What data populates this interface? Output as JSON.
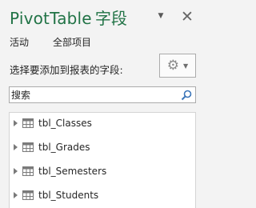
{
  "pane": {
    "title_latin": "PivotTable",
    "title_zh": "字段"
  },
  "tabs": [
    "活动",
    "全部项目"
  ],
  "instruction": "选择要添加到报表的字段:",
  "search": {
    "placeholder": "搜索"
  },
  "fields": [
    {
      "label": "tbl_Classes",
      "icon": "table-icon"
    },
    {
      "label": "tbl_Grades",
      "icon": "table-icon"
    },
    {
      "label": "tbl_Semesters",
      "icon": "table-icon"
    },
    {
      "label": "tbl_Students",
      "icon": "table-icon"
    }
  ],
  "colors": {
    "title": "#217346",
    "background": "#f3f3f3",
    "list_background": "#ffffff",
    "border": "#ababab"
  }
}
